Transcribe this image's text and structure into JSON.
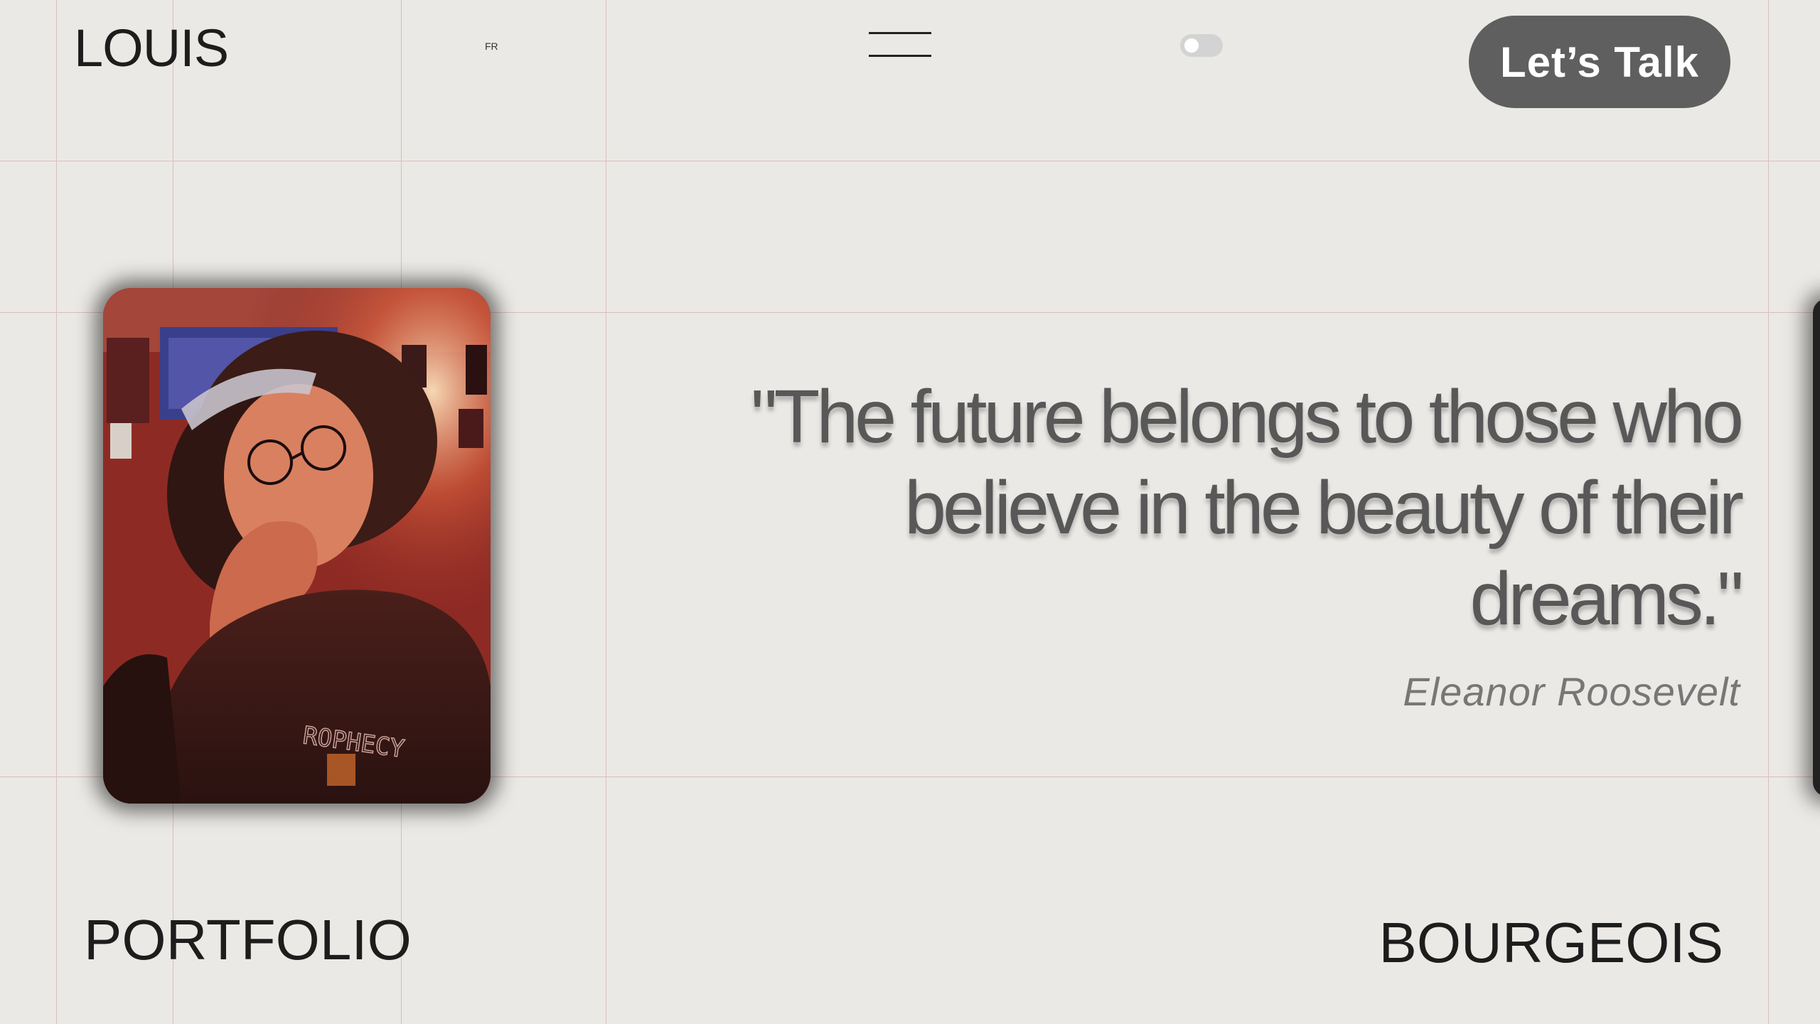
{
  "header": {
    "logo": "LOUIS",
    "language": "FR",
    "cta_label": "Let’s Talk",
    "menu_icon": "hamburger-menu-icon",
    "theme_toggle": "theme-toggle-switch"
  },
  "hero": {
    "photo_icon": "profile-photo",
    "quote": "\"The future belongs to those who believe in the beauty of their dreams.\"",
    "author": "Eleanor Roosevelt"
  },
  "footer": {
    "left_label": "PORTFOLIO",
    "right_label": "BOURGEOIS"
  },
  "colors": {
    "background": "#ebe9e5",
    "cta_background": "#5f5f5f",
    "guide_lines": "#dcbcbc",
    "quote_text": "#585858"
  }
}
